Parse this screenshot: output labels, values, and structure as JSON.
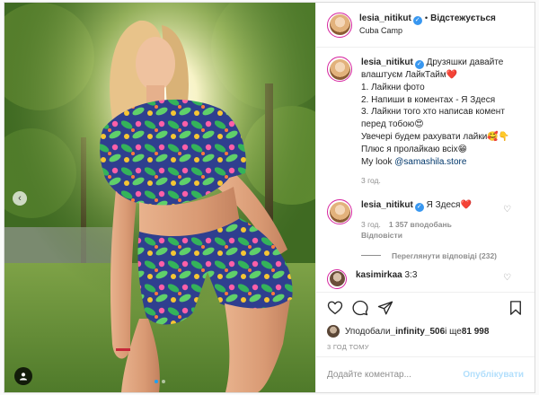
{
  "header": {
    "username": "lesia_nitikut",
    "follow_label": "Відстежується",
    "location": "Cuba Camp"
  },
  "caption": {
    "username": "lesia_nitikut",
    "lines": [
      "Друзяшки давайте влаштуєм ЛайкТайм❤️",
      "1. Лайкни фото",
      "2. Напиши в коментах - Я Здеся",
      "3. Лайкни того хто написав комент перед тобою😍",
      "Увечері будем рахувати лайки🥰👇",
      "Плюс я пролайкаю всіх😁"
    ],
    "mention_prefix": "My look ",
    "mention": "@samashila.store",
    "time": "3 год."
  },
  "comment": {
    "username": "lesia_nitikut",
    "text": "Я Здеся❤️",
    "time": "3 год.",
    "likes": "1 357 вподобань",
    "reply_label": "Відповісти",
    "view_replies": "Переглянути відповіді (232)"
  },
  "partial_comment": {
    "username": "kasimirkaa",
    "text": "3:3"
  },
  "actions": {
    "like_icon": "heart-outline-icon",
    "comment_icon": "comment-bubble-icon",
    "share_icon": "paper-plane-icon",
    "save_icon": "bookmark-icon"
  },
  "likes": {
    "prefix": "Уподобали ",
    "user": "_infinity_506",
    "middle": " і ще ",
    "count": "81 998"
  },
  "timestamp": "3 ГОД ТОМУ",
  "composer": {
    "placeholder": "Додайте коментар...",
    "publish_label": "Опублікувати"
  },
  "colors": {
    "verified": "#3897f0",
    "publish_disabled": "#b2dffc",
    "carousel_active_dot": "#1da1f2",
    "story_ring": "#d6249f"
  },
  "carousel": {
    "total": 2,
    "active_index": 0
  }
}
